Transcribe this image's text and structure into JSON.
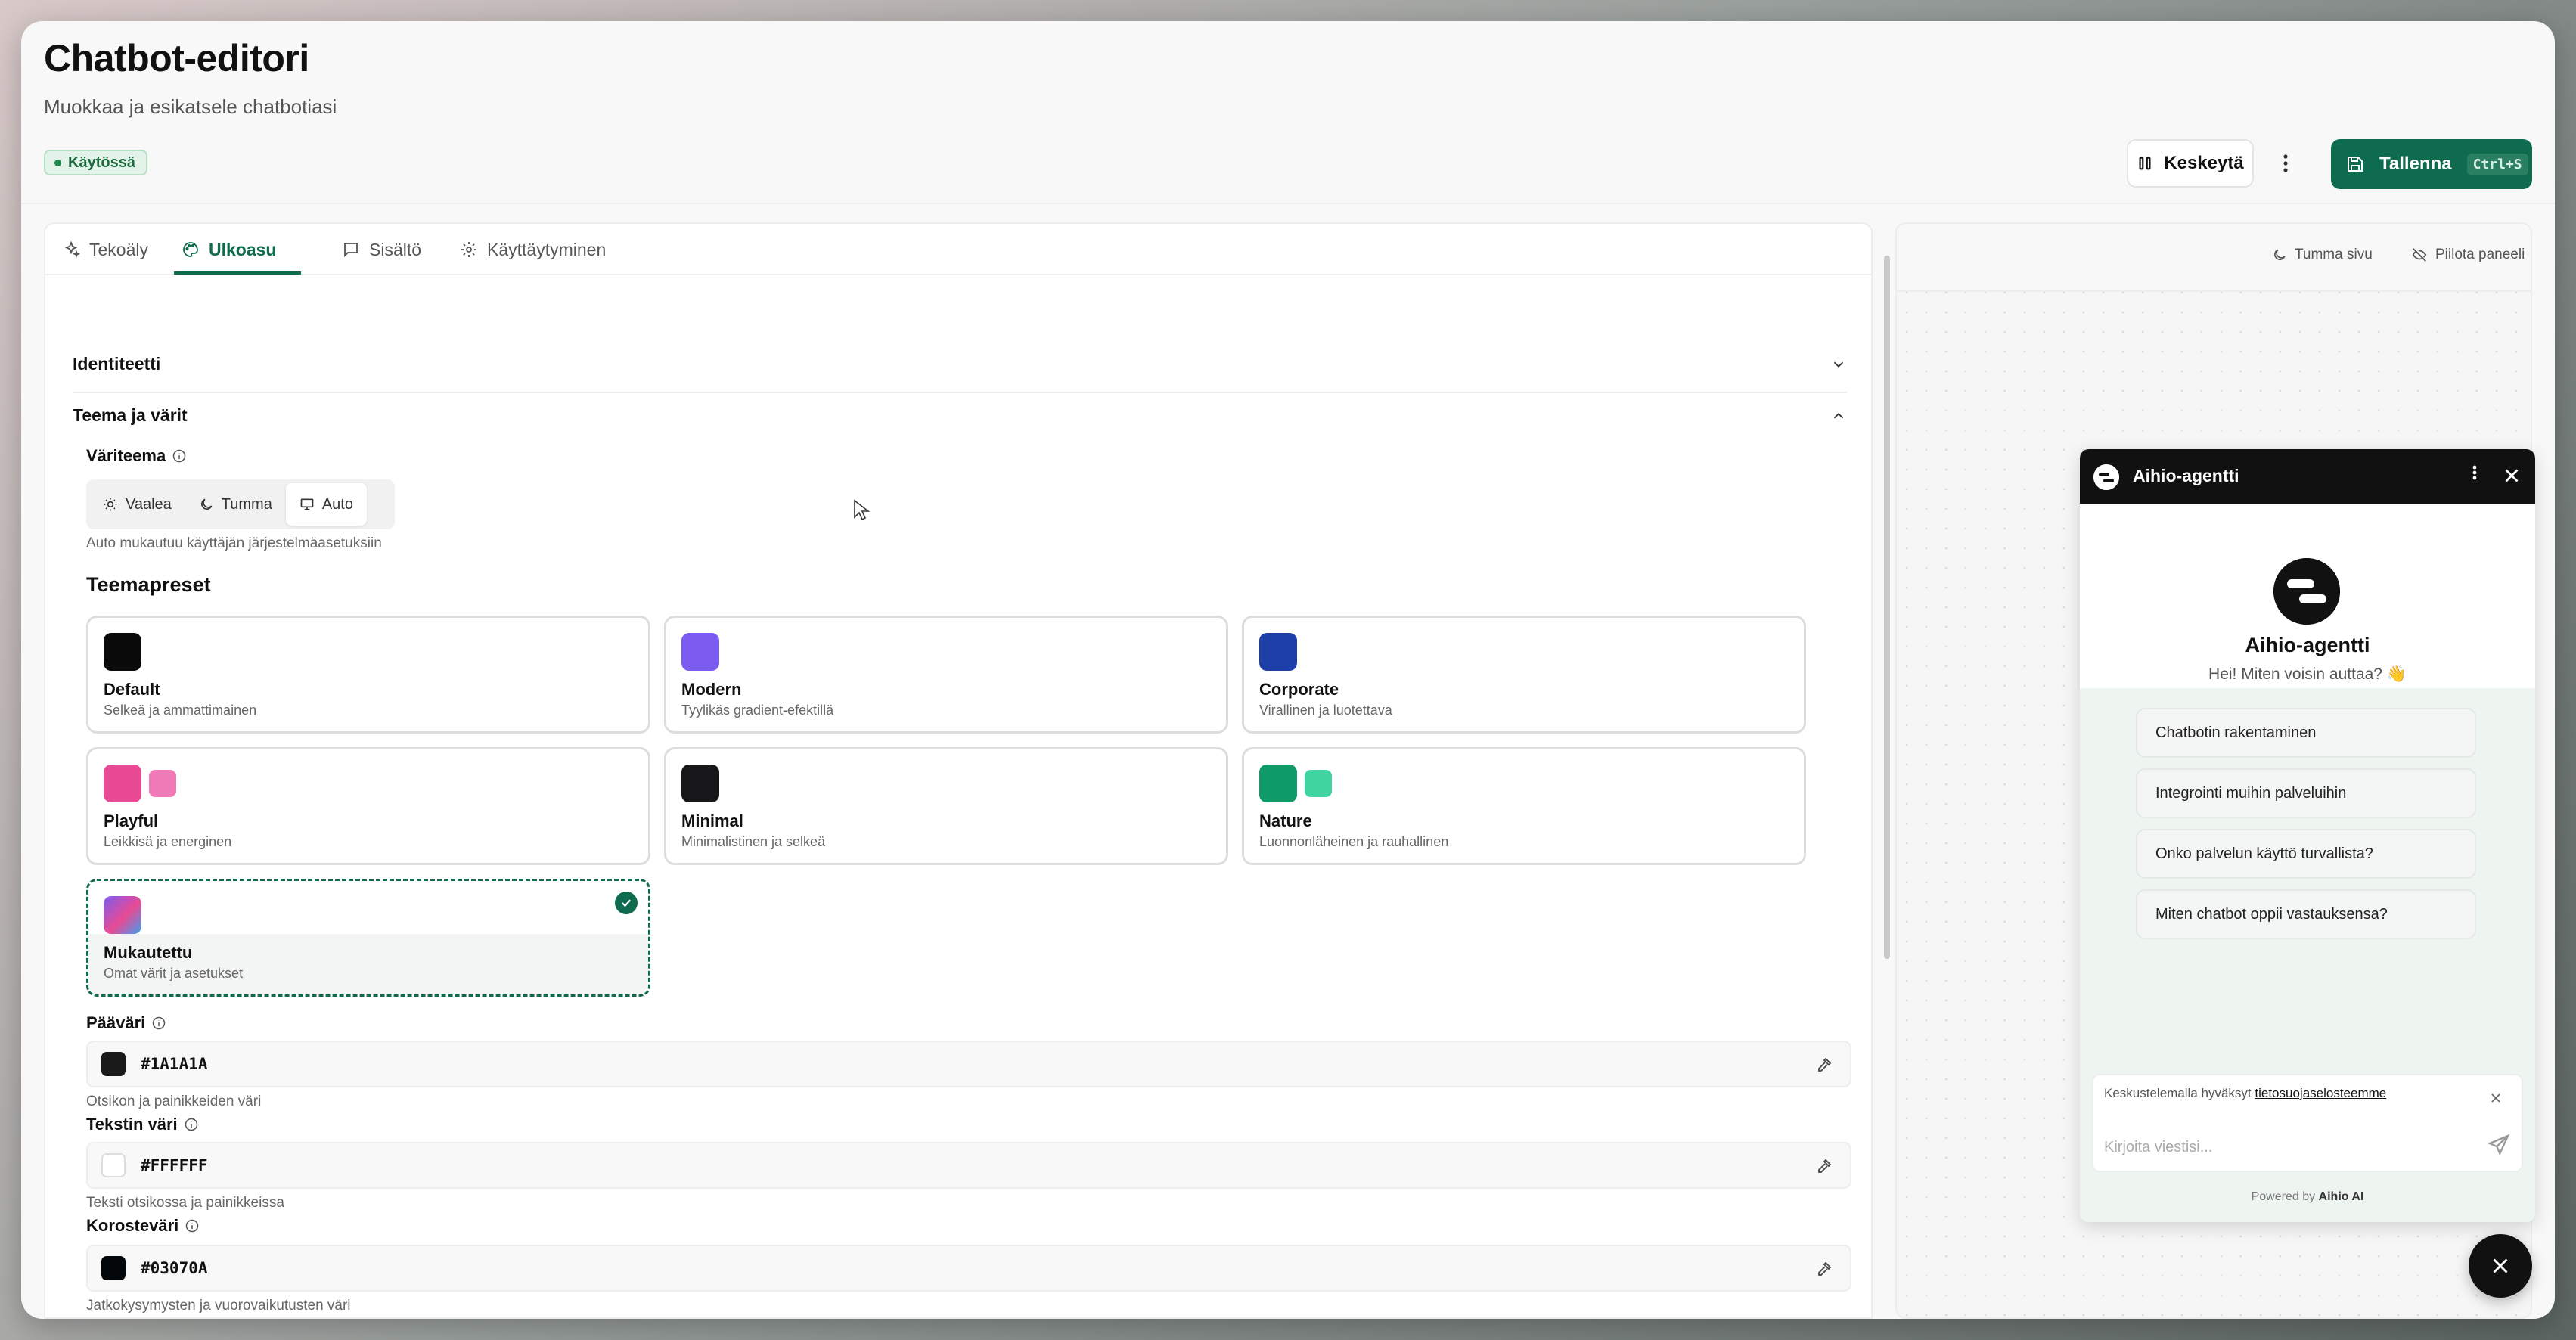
{
  "header": {
    "title": "Chatbot-editori",
    "subtitle": "Muokkaa ja esikatsele chatbotiasi",
    "status": "Käytössä",
    "pause_label": "Keskeytä",
    "save_label": "Tallenna",
    "save_shortcut": "Ctrl+S"
  },
  "tabs": [
    {
      "label": "Tekoäly",
      "icon": "sparkles-icon"
    },
    {
      "label": "Ulkoasu",
      "icon": "palette-icon",
      "active": true
    },
    {
      "label": "Sisältö",
      "icon": "message-square-icon"
    },
    {
      "label": "Käyttäytyminen",
      "icon": "gear-icon"
    }
  ],
  "accordion": {
    "identity": "Identiteetti",
    "theme": "Teema ja värit"
  },
  "color_theme": {
    "label": "Väriteema",
    "options": [
      "Vaalea",
      "Tumma",
      "Auto"
    ],
    "selected": "Auto",
    "hint": "Auto mukautuu käyttäjän järjestelmäasetuksiin"
  },
  "presets": {
    "title": "Teemapreset",
    "items": [
      {
        "name": "Default",
        "desc": "Selkeä ja ammattimainen",
        "color": "#0a0a0a"
      },
      {
        "name": "Modern",
        "desc": "Tyylikäs gradient-efektillä",
        "color": "#7c5cf0"
      },
      {
        "name": "Corporate",
        "desc": "Virallinen ja luotettava",
        "color": "#1e3ea8"
      },
      {
        "name": "Playful",
        "desc": "Leikkisä ja energinen",
        "color": "#e84a93",
        "secondary": "#f07ab8"
      },
      {
        "name": "Minimal",
        "desc": "Minimalistinen ja selkeä",
        "color": "#18181b"
      },
      {
        "name": "Nature",
        "desc": "Luonnonläheinen ja rauhallinen",
        "color": "#0f9b68",
        "secondary": "#3fd4a0"
      },
      {
        "name": "Mukautettu",
        "desc": "Omat värit ja asetukset",
        "selected": true
      }
    ]
  },
  "colors": {
    "primary": {
      "label": "Pääväri",
      "value": "#1A1A1A",
      "hint": "Otsikon ja painikkeiden väri",
      "swatch": "#1a1a1a"
    },
    "text": {
      "label": "Tekstin väri",
      "value": "#FFFFFF",
      "hint": "Teksti otsikossa ja painikkeissa",
      "swatch": "#ffffff"
    },
    "accent": {
      "label": "Korosteväri",
      "value": "#03070A",
      "hint": "Jatkokysymysten ja vuorovaikutusten väri",
      "swatch": "#03070a"
    }
  },
  "preview": {
    "dark_page": "Tumma sivu",
    "hide_panel": "Piilota paneeli"
  },
  "chat": {
    "title": "Aihio-agentti",
    "bot_name": "Aihio-agentti",
    "greeting": "Hei! Miten voisin auttaa? 👋",
    "suggestions": [
      "Chatbotin rakentaminen",
      "Integrointi muihin palveluihin",
      "Onko palvelun käyttö turvallista?",
      "Miten chatbot oppii vastauksensa?"
    ],
    "consent_prefix": "Keskustelemalla hyväksyt",
    "consent_link": "tietosuojaselosteemme",
    "placeholder": "Kirjoita viestisi...",
    "powered_prefix": "Powered by",
    "powered_brand": "Aihio AI"
  },
  "accent_color": "#0e6b4e"
}
